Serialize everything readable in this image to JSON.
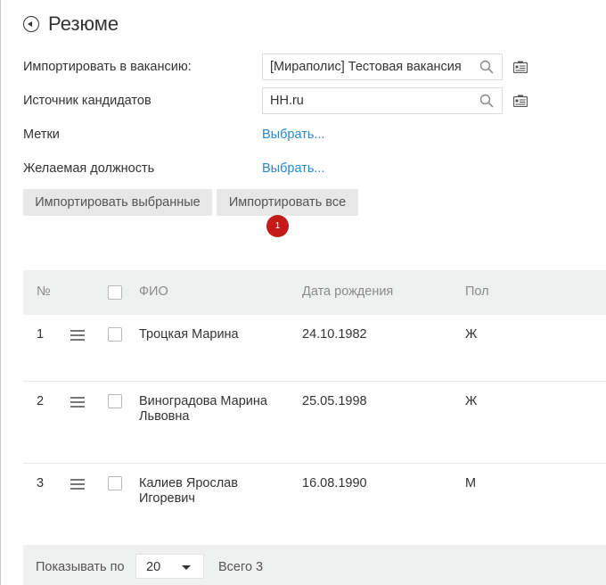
{
  "header": {
    "title": "Резюме"
  },
  "form": {
    "vacancy": {
      "label": "Импортировать в вакансию:",
      "value": "[Мираполис] Тестовая вакансия"
    },
    "source": {
      "label": "Источник кандидатов",
      "value": "HH.ru"
    },
    "tags": {
      "label": "Метки",
      "link": "Выбрать..."
    },
    "position": {
      "label": "Желаемая должность",
      "link": "Выбрать..."
    }
  },
  "buttons": {
    "import_selected": "Импортировать выбранные",
    "import_all": "Импортировать все",
    "badge": "1"
  },
  "table": {
    "columns": {
      "num": "№",
      "name": "ФИО",
      "birth": "Дата рождения",
      "gender": "Пол"
    },
    "rows": [
      {
        "num": "1",
        "name_line1": "Троцкая Марина",
        "name_line2": "",
        "birth": "24.10.1982",
        "gender": "Ж"
      },
      {
        "num": "2",
        "name_line1": "Виноградова Марина",
        "name_line2": "Львовна",
        "birth": "25.05.1998",
        "gender": "Ж"
      },
      {
        "num": "3",
        "name_line1": "Калиев Ярослав",
        "name_line2": "Игоревич",
        "birth": "16.08.1990",
        "gender": "М"
      }
    ]
  },
  "footer": {
    "show_label": "Показывать по",
    "page_size": "20",
    "total": "Всего 3"
  },
  "colors": {
    "accent_link": "#2b87c8",
    "badge": "#c41a1a",
    "header_bg": "#eff1f1",
    "button_bg": "#e7e7e7"
  }
}
